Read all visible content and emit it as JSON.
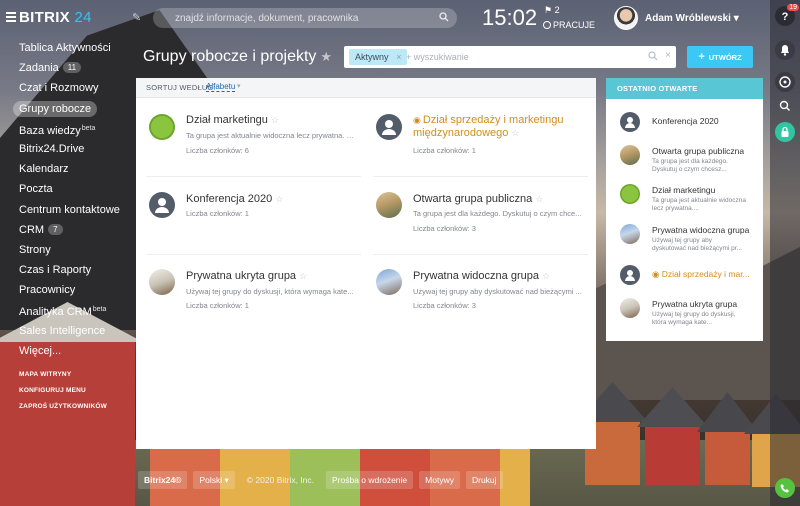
{
  "header": {
    "logo_text": "BITRIX",
    "logo_num": "24",
    "search_placeholder": "znajdź informacje, dokument, pracownika",
    "clock": "15:02",
    "flag_count": "2",
    "work_status": "PRACUJE",
    "user_name": "Adam Wróblewski"
  },
  "rail": {
    "help_badge": "19"
  },
  "sidebar": {
    "items": [
      {
        "label": "Tablica Aktywności"
      },
      {
        "label": "Zadania",
        "count": "11"
      },
      {
        "label": "Czat i Rozmowy"
      },
      {
        "label": "Grupy robocze",
        "active": true
      },
      {
        "label": "Baza wiedzy",
        "beta": "beta"
      },
      {
        "label": "Bitrix24.Drive"
      },
      {
        "label": "Kalendarz"
      },
      {
        "label": "Poczta"
      },
      {
        "label": "Centrum kontaktowe"
      },
      {
        "label": "CRM",
        "count": "7"
      },
      {
        "label": "Strony"
      },
      {
        "label": "Czas i Raporty"
      },
      {
        "label": "Pracownicy"
      },
      {
        "label": "Analityka CRM",
        "beta": "beta"
      },
      {
        "label": "Sales Intelligence"
      },
      {
        "label": "Więcej..."
      }
    ],
    "small": [
      "MAPA WITRYNY",
      "KONFIGURUJ MENU",
      "ZAPROŚ UŻYTKOWNIKÓW"
    ]
  },
  "page": {
    "title": "Grupy robocze i projekty",
    "filter_tag": "Aktywny",
    "filter_placeholder": "+ wyszukiwanie",
    "create_label": "UTWÓRZ",
    "sort_label": "SORTUJ WEDŁUG:",
    "sort_value": "Alfabetu"
  },
  "groups": [
    {
      "title": "Dział marketingu",
      "desc": "Ta grupa jest aktualnie widoczna lecz prywatna. Z...",
      "members": "Liczba członków: 6",
      "icon": "image-green"
    },
    {
      "title": "Dział sprzedaży i marketingu międzynarodowego",
      "desc": "",
      "members": "Liczba członków: 1",
      "icon": "default",
      "orange": true
    },
    {
      "title": "Konferencja 2020",
      "desc": "",
      "members": "Liczba członków: 1",
      "icon": "default"
    },
    {
      "title": "Otwarta grupa publiczna",
      "desc": "Ta grupa jest dla każdego. Dyskutuj o czym chce...",
      "members": "Liczba członków: 3",
      "icon": "image-paris"
    },
    {
      "title": "Prywatna ukryta grupa",
      "desc": "Używaj tej grupy do dyskusji, która wymaga kate...",
      "members": "Liczba członków: 1",
      "icon": "image-door"
    },
    {
      "title": "Prywatna widoczna grupa",
      "desc": "Używaj tej grupy aby dyskutować nad bieżącymi ...",
      "members": "Liczba członków: 3",
      "icon": "image-city"
    }
  ],
  "recent": {
    "title": "OSTATNIO OTWARTE",
    "items": [
      {
        "title": "Konferencja 2020",
        "d1": "",
        "d2": "",
        "icon": "default"
      },
      {
        "title": "Otwarta grupa publiczna",
        "d1": "Ta grupa jest dla każdego.",
        "d2": "Dyskutuj o czym chcesz...",
        "icon": "image-paris"
      },
      {
        "title": "Dział marketingu",
        "d1": "Ta grupa jest aktualnie widoczna",
        "d2": "lecz prywatna....",
        "icon": "image-green"
      },
      {
        "title": "Prywatna widoczna grupa",
        "d1": "Używaj tej grupy aby",
        "d2": "dyskutować nad bieżącymi pr...",
        "icon": "image-city"
      },
      {
        "title": "Dział sprzedaży i mar...",
        "d1": "",
        "d2": "",
        "icon": "default",
        "orange": true
      },
      {
        "title": "Prywatna ukryta grupa",
        "d1": "Używaj tej grupy do dyskusji,",
        "d2": "która wymaga kate...",
        "icon": "image-door"
      }
    ]
  },
  "footer": {
    "brand": "Bitrix24©",
    "lang": "Polski",
    "copyright": "© 2020 Bitrix, Inc.",
    "links": [
      "Prośba o wdrożenie",
      "Motywy",
      "Drukuj"
    ]
  }
}
